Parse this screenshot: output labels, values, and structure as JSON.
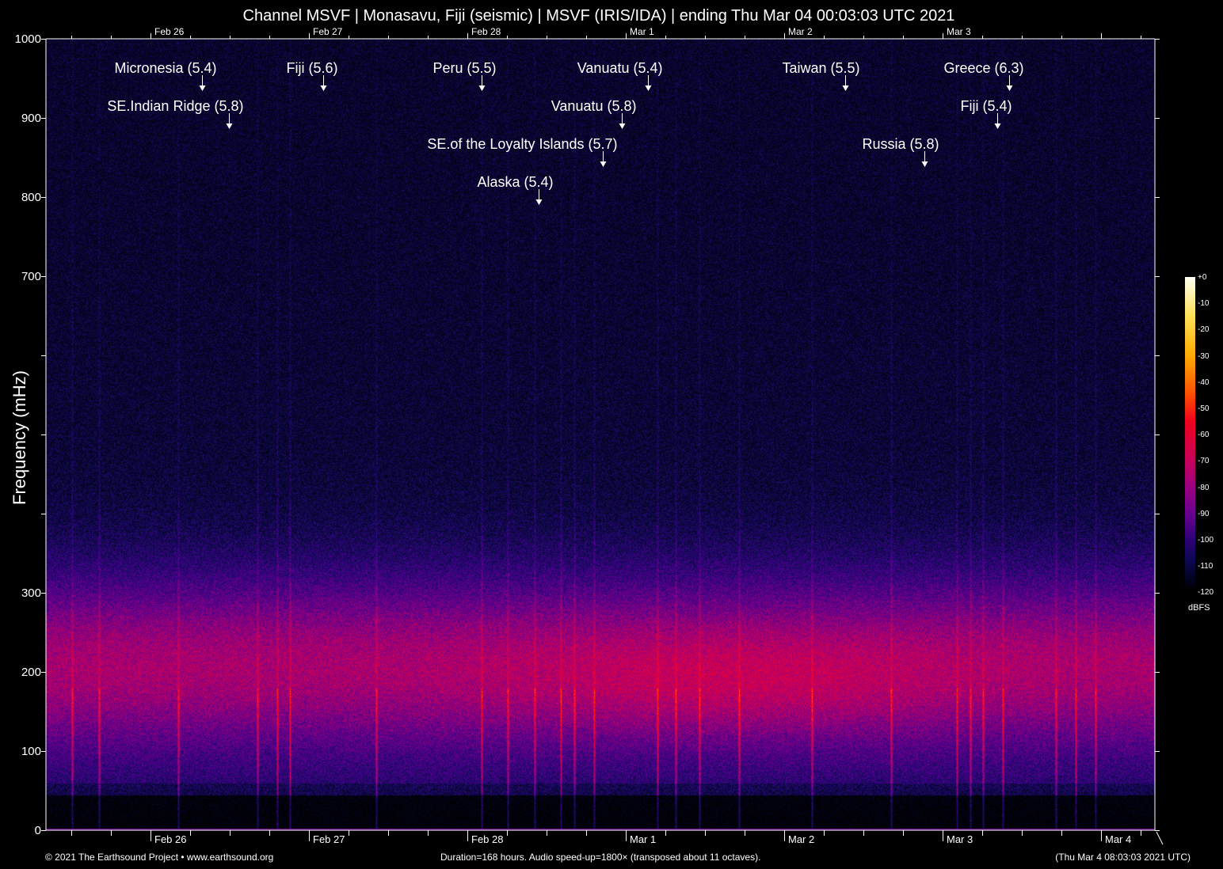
{
  "title": "Channel MSVF | Monasavu, Fiji (seismic) | MSVF (IRIS/IDA) | ending Thu Mar 04 00:03:03 UTC 2021",
  "chart_data": {
    "type": "heatmap",
    "title": "Channel MSVF | Monasavu, Fiji (seismic) | MSVF (IRIS/IDA) | ending Thu Mar 04 00:03:03 UTC 2021",
    "xlabel": "",
    "ylabel": "Frequency (mHz)",
    "xlim_hours": [
      0,
      168
    ],
    "ylim": [
      0,
      1000
    ],
    "y_ticks": [
      0,
      100,
      200,
      300,
      400,
      500,
      600,
      700,
      800,
      900,
      1000
    ],
    "y_tick_labels": [
      "0",
      "100",
      "200",
      "300",
      "",
      "",
      "",
      "700",
      "800",
      "900",
      "1000"
    ],
    "x_tick_labels": [
      {
        "label": "Feb 26",
        "hour": 15.84
      },
      {
        "label": "Feb 27",
        "hour": 39.84
      },
      {
        "label": "Feb 28",
        "hour": 63.84
      },
      {
        "label": "Mar  1",
        "hour": 87.84
      },
      {
        "label": "Mar  2",
        "hour": 111.84
      },
      {
        "label": "Mar  3",
        "hour": 135.84
      },
      {
        "label": "Mar  4",
        "hour": 159.84
      }
    ],
    "top_x_tick_labels": [
      "Feb 26",
      "Feb 27",
      "Feb 28",
      "Mar  1",
      "Mar  2",
      "Mar  3"
    ],
    "colorbar": {
      "unit": "dBFS",
      "range": [
        -120,
        0
      ],
      "ticks": [
        "+0",
        "-10",
        "-20",
        "-30",
        "-40",
        "-50",
        "-60",
        "-70",
        "-80",
        "-90",
        "-100",
        "-110",
        "-120"
      ]
    },
    "events": [
      {
        "label": "Micronesia (5.4)",
        "hour": 23.6,
        "row": 0
      },
      {
        "label": "SE.Indian Ridge (5.8)",
        "hour": 27.7,
        "row": 1
      },
      {
        "label": "Fiji (5.6)",
        "hour": 42.0,
        "row": 0
      },
      {
        "label": "Peru (5.5)",
        "hour": 66.0,
        "row": 0
      },
      {
        "label": "Alaska (5.4)",
        "hour": 74.6,
        "row": 3
      },
      {
        "label": "SE.of the Loyalty Islands (5.7)",
        "hour": 84.4,
        "row": 2
      },
      {
        "label": "Vanuatu (5.8)",
        "hour": 87.2,
        "row": 1
      },
      {
        "label": "Vanuatu (5.4)",
        "hour": 91.2,
        "row": 0
      },
      {
        "label": "Taiwan (5.5)",
        "hour": 121.1,
        "row": 0
      },
      {
        "label": "Russia (5.8)",
        "hour": 133.1,
        "row": 2
      },
      {
        "label": "Fiji (5.4)",
        "hour": 144.1,
        "row": 1
      },
      {
        "label": "Greece (6.3)",
        "hour": 145.9,
        "row": 0
      }
    ],
    "streak_hours": [
      4,
      8,
      20,
      32,
      35,
      37,
      50,
      66,
      70,
      74,
      78,
      80,
      83,
      92.6,
      95.4,
      99,
      105,
      116,
      128,
      138,
      140,
      142,
      145,
      153,
      156,
      159
    ]
  },
  "footer": {
    "copyright": "© 2021 The Earthsound Project • www.earthsound.org",
    "duration": "Duration=168 hours. Audio speed-up=1800× (transposed about 11 octaves).",
    "timestamp": "(Thu Mar  4 08:03:03 2021 UTC)"
  }
}
